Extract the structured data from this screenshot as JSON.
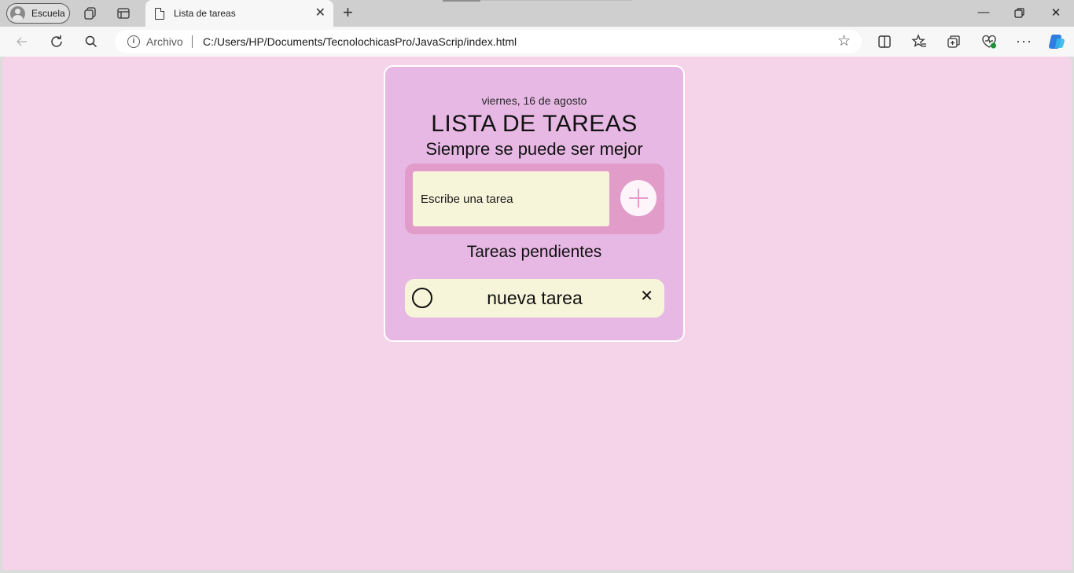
{
  "browser": {
    "profile_label": "Escuela",
    "tab_title": "Lista de tareas",
    "address_scheme": "Archivo",
    "address_url": "C:/Users/HP/Documents/TecnolochicasPro/JavaScrip/index.html"
  },
  "app": {
    "date": "viernes, 16 de agosto",
    "title": "LISTA DE TAREAS",
    "subtitle": "Siempre se puede ser mejor",
    "input_placeholder": "Escribe una tarea",
    "pending_heading": "Tareas pendientes",
    "tasks": [
      {
        "text": "nueva tarea",
        "completed": false
      }
    ]
  },
  "colors": {
    "page_background": "#f5d4ea",
    "card_background": "#e6b8e3",
    "input_panel": "#e19cc9",
    "input_and_task_background": "#f6f4d9",
    "add_button_plus": "#e59ccb"
  }
}
